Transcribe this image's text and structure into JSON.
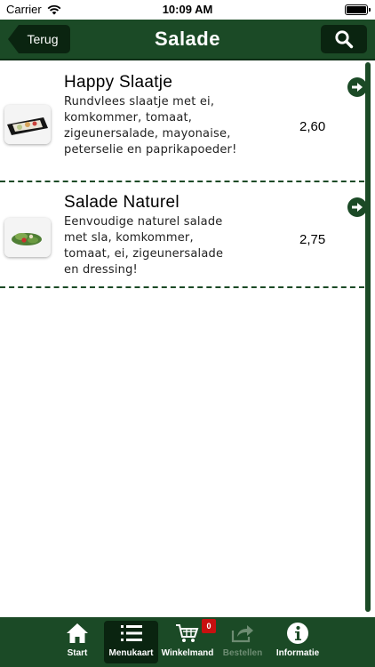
{
  "status_bar": {
    "carrier": "Carrier",
    "time": "10:09 AM",
    "battery_level": 1.0
  },
  "nav": {
    "back_label": "Terug",
    "title": "Salade",
    "search_icon": "search-icon"
  },
  "items": [
    {
      "title": "Happy Slaatje",
      "description": "Rundvlees slaatje met ei, komkommer, tomaat, zigeunersalade, mayonaise, peterselie en paprikapoeder!",
      "price": "2,60"
    },
    {
      "title": "Salade Naturel",
      "description": "Eenvoudige naturel salade met sla, komkommer, tomaat, ei, zigeunersalade en dressing!",
      "price": "2,75"
    }
  ],
  "tabs": [
    {
      "label": "Start",
      "icon": "home-icon",
      "selected": false,
      "enabled": true
    },
    {
      "label": "Menukaart",
      "icon": "list-icon",
      "selected": true,
      "enabled": true
    },
    {
      "label": "Winkelmand",
      "icon": "cart-icon",
      "selected": false,
      "enabled": true
    },
    {
      "label": "Bestellen",
      "icon": "share-icon",
      "selected": false,
      "enabled": false
    },
    {
      "label": "Informatie",
      "icon": "info-icon",
      "selected": false,
      "enabled": true
    }
  ],
  "cart_badge": "0",
  "colors": {
    "primary": "#1b4a26",
    "dark": "#0a2410",
    "badge": "#c81010"
  }
}
